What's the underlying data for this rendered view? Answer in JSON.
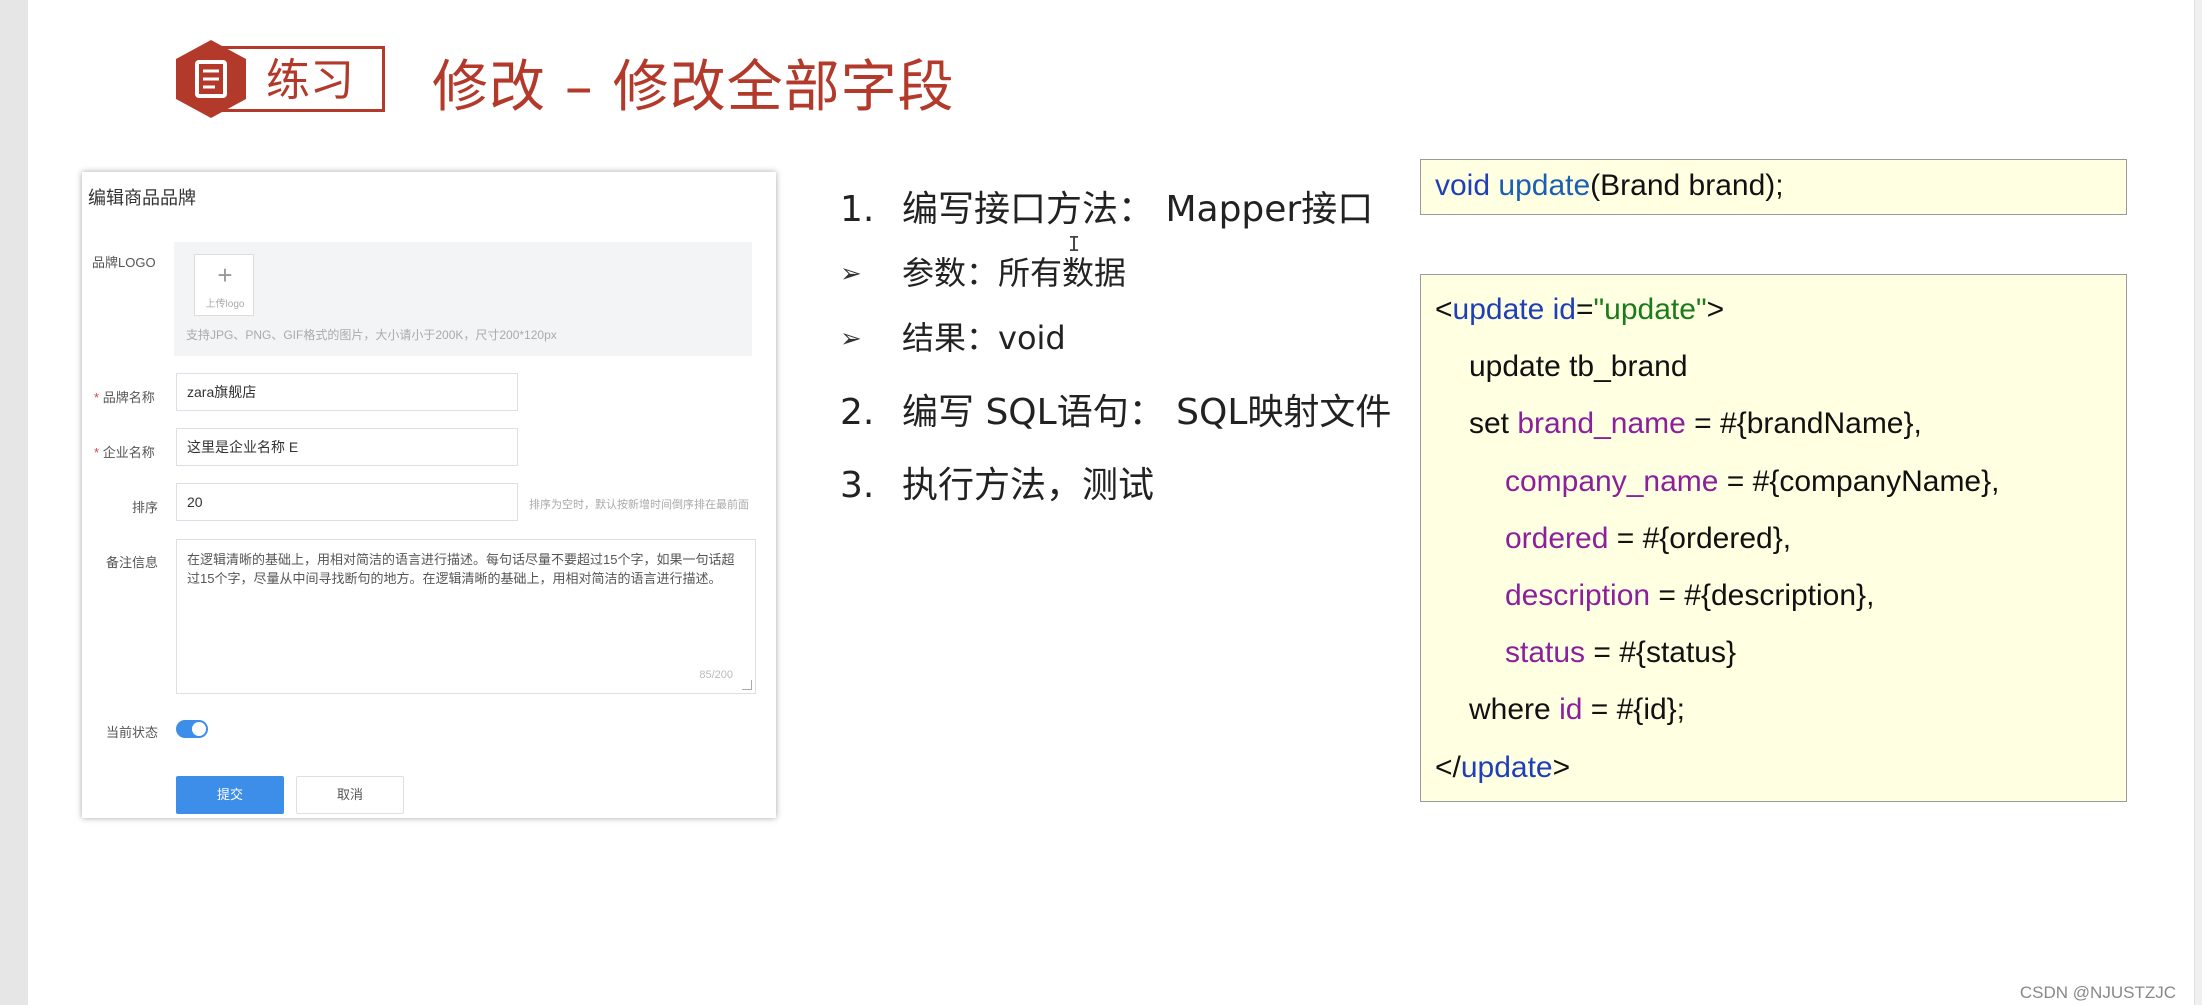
{
  "header": {
    "badge_label": "练习",
    "title": "修改 – 修改全部字段",
    "accent_color": "#b33a2b",
    "badge_icon": "document-icon"
  },
  "form": {
    "title": "编辑商品品牌",
    "logo_label": "品牌LOGO",
    "upload_label": "上传logo",
    "upload_hint": "支持JPG、PNG、GIF格式的图片，大小请小于200K，尺寸200*120px",
    "brand_name_label": "品牌名称",
    "brand_name_value": "zara旗舰店",
    "company_name_label": "企业名称",
    "company_name_value": "这里是企业名称 E",
    "order_label": "排序",
    "order_value": "20",
    "order_hint": "排序为空时，默认按新增时间倒序排在最前面",
    "description_label": "备注信息",
    "description_value": "在逻辑清晰的基础上，用相对简洁的语言进行描述。每句话尽量不要超过15个字，如果一句话超过15个字，尽量从中间寻找断句的地方。在逻辑清晰的基础上，用相对简洁的语言进行描述。",
    "description_counter": "85/200",
    "status_label": "当前状态",
    "status_on": true,
    "submit_label": "提交",
    "cancel_label": "取消",
    "required_mark": "*"
  },
  "steps": [
    {
      "marker": "1.",
      "text": "编写接口方法： Mapper接口"
    },
    {
      "marker": "➢",
      "text": "参数：所有数据"
    },
    {
      "marker": "➢",
      "text": "结果：void"
    },
    {
      "marker": "2.",
      "text": "编写 SQL语句： SQL映射文件"
    },
    {
      "marker": "3.",
      "text": "执行方法，测试"
    }
  ],
  "code": {
    "method_void": "void",
    "method_name": "update",
    "method_rest": "(Brand brand);",
    "xml_open_lt": "<",
    "xml_tag": "update",
    "xml_attr": "id",
    "xml_eq": "=",
    "xml_attr_value": "\"update\"",
    "xml_gt": ">",
    "line_update": "update tb_brand",
    "line_set": "set",
    "col_brand_name": "brand_name",
    "val_brand_name": " = #{brandName},",
    "col_company_name": "company_name",
    "val_company_name": " = #{companyName},",
    "col_ordered": "ordered",
    "val_ordered": " = #{ordered},",
    "col_description": "description",
    "val_description": " = #{description},",
    "col_status": "status",
    "val_status": " = #{status}",
    "line_where": "where",
    "col_id": "id",
    "val_id": " = #{id};",
    "xml_close_lt": "</",
    "xml_close_tag": "update",
    "xml_close_gt": ">"
  },
  "watermark": "CSDN @NJUSTZJC"
}
